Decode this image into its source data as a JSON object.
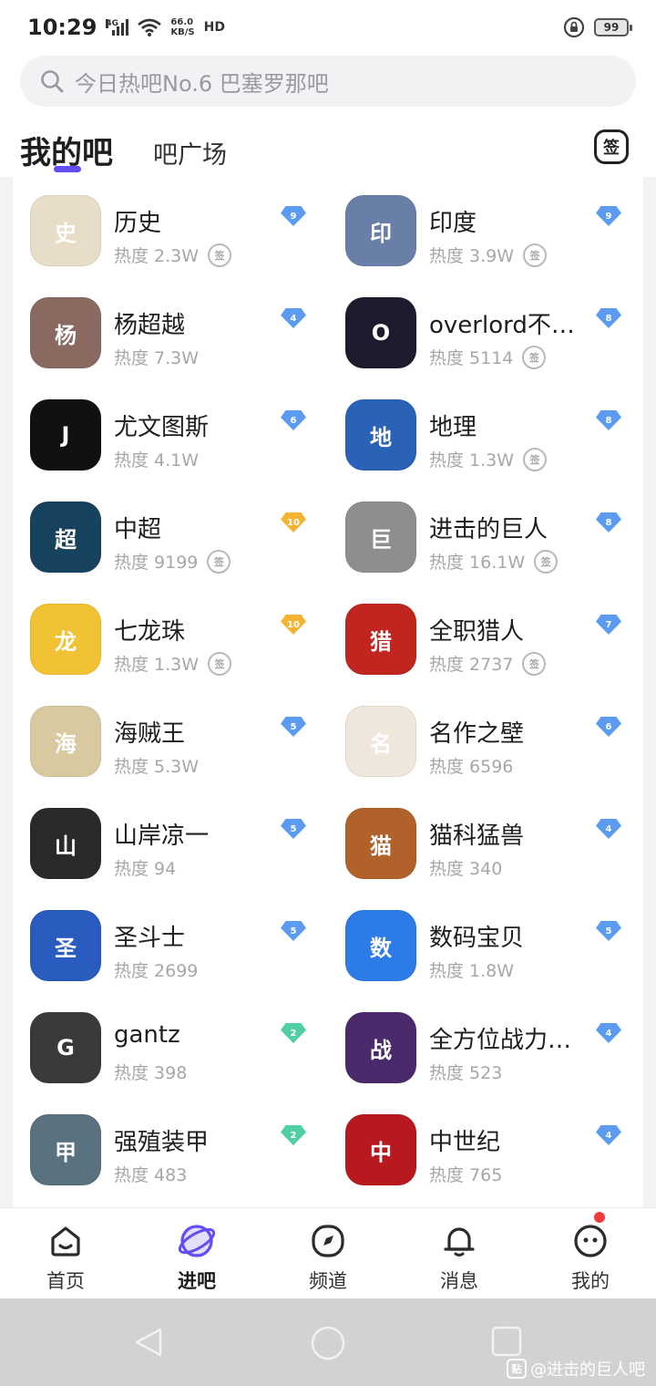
{
  "status_bar": {
    "time": "10:29",
    "network": "4G",
    "speed_value": "66.0",
    "speed_unit": "KB/S",
    "hd": "HD",
    "battery": "99"
  },
  "search": {
    "placeholder": "今日热吧No.6 巴塞罗那吧"
  },
  "tabs": {
    "mine": "我的吧",
    "square": "吧广场",
    "sign_label": "签"
  },
  "forums": [
    {
      "name": "历史",
      "heat": "热度 2.3W",
      "level": "9",
      "signed": true,
      "level_color": "#5b9cf0",
      "avatar_color": "#e8ddc8",
      "avatar_text": "史"
    },
    {
      "name": "印度",
      "heat": "热度 3.9W",
      "level": "9",
      "signed": true,
      "level_color": "#5b9cf0",
      "avatar_color": "#6a7fa8",
      "avatar_text": "印"
    },
    {
      "name": "杨超越",
      "heat": "热度 7.3W",
      "level": "4",
      "signed": false,
      "level_color": "#5b9cf0",
      "avatar_color": "#8a6a60",
      "avatar_text": "杨"
    },
    {
      "name": "overlord不死…",
      "heat": "热度 5114",
      "level": "8",
      "signed": true,
      "level_color": "#5b9cf0",
      "avatar_color": "#1f1a2e",
      "avatar_text": "O"
    },
    {
      "name": "尤文图斯",
      "heat": "热度 4.1W",
      "level": "6",
      "signed": false,
      "level_color": "#5b9cf0",
      "avatar_color": "#111111",
      "avatar_text": "J"
    },
    {
      "name": "地理",
      "heat": "热度 1.3W",
      "level": "8",
      "signed": true,
      "level_color": "#5b9cf0",
      "avatar_color": "#2a62b8",
      "avatar_text": "地"
    },
    {
      "name": "中超",
      "heat": "热度 9199",
      "level": "10",
      "signed": true,
      "level_color": "#f4b334",
      "avatar_color": "#17425e",
      "avatar_text": "超"
    },
    {
      "name": "进击的巨人",
      "heat": "热度 16.1W",
      "level": "8",
      "signed": true,
      "level_color": "#5b9cf0",
      "avatar_color": "#8e8e8e",
      "avatar_text": "巨"
    },
    {
      "name": "七龙珠",
      "heat": "热度 1.3W",
      "level": "10",
      "signed": true,
      "level_color": "#f4b334",
      "avatar_color": "#f1c233",
      "avatar_text": "龙"
    },
    {
      "name": "全职猎人",
      "heat": "热度 2737",
      "level": "7",
      "signed": true,
      "level_color": "#5b9cf0",
      "avatar_color": "#c0251f",
      "avatar_text": "猎"
    },
    {
      "name": "海贼王",
      "heat": "热度 5.3W",
      "level": "5",
      "signed": false,
      "level_color": "#5b9cf0",
      "avatar_color": "#d8c9a0",
      "avatar_text": "海"
    },
    {
      "name": "名作之壁",
      "heat": "热度 6596",
      "level": "6",
      "signed": false,
      "level_color": "#5b9cf0",
      "avatar_color": "#efe6dc",
      "avatar_text": "名"
    },
    {
      "name": "山岸凉一",
      "heat": "热度 94",
      "level": "5",
      "signed": false,
      "level_color": "#5b9cf0",
      "avatar_color": "#2a2a2a",
      "avatar_text": "山"
    },
    {
      "name": "猫科猛兽",
      "heat": "热度 340",
      "level": "4",
      "signed": false,
      "level_color": "#5b9cf0",
      "avatar_color": "#b0622a",
      "avatar_text": "猫"
    },
    {
      "name": "圣斗士",
      "heat": "热度 2699",
      "level": "5",
      "signed": false,
      "level_color": "#5b9cf0",
      "avatar_color": "#2a5bbf",
      "avatar_text": "圣"
    },
    {
      "name": "数码宝贝",
      "heat": "热度 1.8W",
      "level": "5",
      "signed": false,
      "level_color": "#5b9cf0",
      "avatar_color": "#2d7be6",
      "avatar_text": "数"
    },
    {
      "name": "gantz",
      "heat": "热度 398",
      "level": "2",
      "signed": false,
      "level_color": "#4fcfa3",
      "avatar_color": "#3a3a3a",
      "avatar_text": "G"
    },
    {
      "name": "全方位战力对…",
      "heat": "热度 523",
      "level": "4",
      "signed": false,
      "level_color": "#5b9cf0",
      "avatar_color": "#4a2a6a",
      "avatar_text": "战"
    },
    {
      "name": "强殖装甲",
      "heat": "热度 483",
      "level": "2",
      "signed": false,
      "level_color": "#4fcfa3",
      "avatar_color": "#5a7280",
      "avatar_text": "甲"
    },
    {
      "name": "中世纪",
      "heat": "热度 765",
      "level": "4",
      "signed": false,
      "level_color": "#5b9cf0",
      "avatar_color": "#b8191e",
      "avatar_text": "中"
    }
  ],
  "bottom_nav": {
    "home": "首页",
    "forums": "进吧",
    "channel": "频道",
    "messages": "消息",
    "mine": "我的"
  },
  "watermark": {
    "logo": "贴",
    "text": "@进击的巨人吧"
  },
  "colors": {
    "accent": "#614ef6",
    "notification": "#f43b3b"
  }
}
